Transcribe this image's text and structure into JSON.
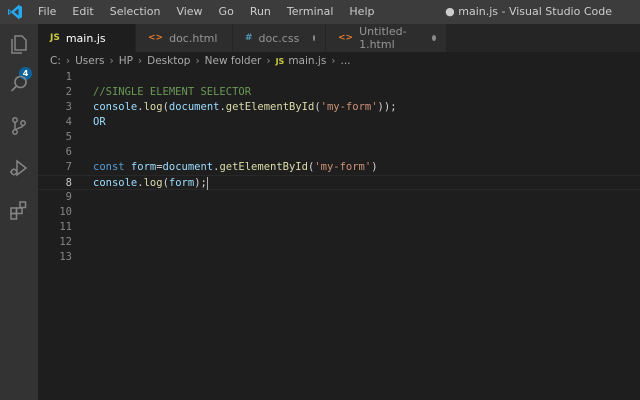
{
  "window": {
    "menu": [
      "File",
      "Edit",
      "Selection",
      "View",
      "Go",
      "Run",
      "Terminal",
      "Help"
    ],
    "title": "● main.js - Visual Studio Code"
  },
  "activity": {
    "badge": "4",
    "items": [
      "explorer-icon",
      "search-icon",
      "source-control-icon",
      "run-debug-icon",
      "extensions-icon"
    ]
  },
  "tabs": [
    {
      "icon": "JS",
      "icon_color": "#cbcb41",
      "label": "main.js",
      "active": true
    },
    {
      "icon": "<>",
      "icon_color": "#e37933",
      "label": "doc.html",
      "active": false
    },
    {
      "icon": "#",
      "icon_color": "#519aba",
      "label": "doc.css",
      "active": false
    },
    {
      "icon": "<>",
      "icon_color": "#e37933",
      "label": "Untitled-1.html",
      "active": false
    }
  ],
  "breadcrumb": {
    "parts": [
      "C:",
      "Users",
      "HP",
      "Desktop",
      "New folder"
    ],
    "file_icon": "JS",
    "file": "main.js",
    "more": "..."
  },
  "editor": {
    "line_numbers": [
      "1",
      "2",
      "3",
      "4",
      "5",
      "6",
      "7",
      "8",
      "9",
      "10",
      "11",
      "12",
      "13"
    ],
    "active_line": "8",
    "lines": {
      "l2_comment": "//SINGLE ELEMENT SELECTOR",
      "l3_console": "console",
      "l3_dot": ".",
      "l3_log": "log",
      "l3_open": "(",
      "l3_document": "document",
      "l3_dot2": ".",
      "l3_getById": "getElementById",
      "l3_open2": "(",
      "l3_str": "'my-form'",
      "l3_close": "));",
      "l4_or": "OR",
      "l7_const": "const",
      "l7_form": " form",
      "l7_eq": "=",
      "l7_document": "document",
      "l7_dot": ".",
      "l7_getById": "getElementById",
      "l7_open": "(",
      "l7_str": "'my-form'",
      "l7_close": ")",
      "l8_console": "console",
      "l8_dot": ".",
      "l8_log": "log",
      "l8_open": "(",
      "l8_form": "form",
      "l8_close": ");"
    }
  }
}
